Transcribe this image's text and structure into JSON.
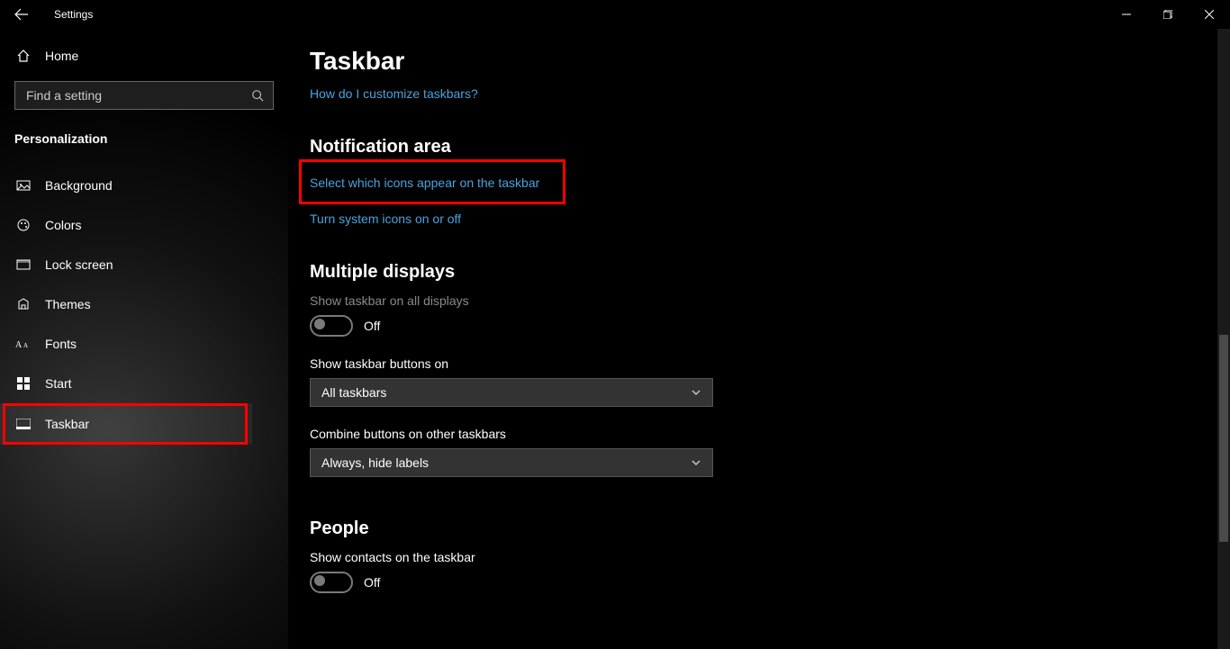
{
  "window": {
    "title": "Settings"
  },
  "sidebar": {
    "home": "Home",
    "search_placeholder": "Find a setting",
    "category": "Personalization",
    "items": [
      {
        "label": "Background"
      },
      {
        "label": "Colors"
      },
      {
        "label": "Lock screen"
      },
      {
        "label": "Themes"
      },
      {
        "label": "Fonts"
      },
      {
        "label": "Start"
      },
      {
        "label": "Taskbar"
      }
    ]
  },
  "content": {
    "title": "Taskbar",
    "help_link": "How do I customize taskbars?",
    "notification_area": {
      "heading": "Notification area",
      "link1": "Select which icons appear on the taskbar",
      "link2": "Turn system icons on or off"
    },
    "multiple_displays": {
      "heading": "Multiple displays",
      "show_all_label": "Show taskbar on all displays",
      "show_all_state": "Off",
      "buttons_on_label": "Show taskbar buttons on",
      "buttons_on_value": "All taskbars",
      "combine_label": "Combine buttons on other taskbars",
      "combine_value": "Always, hide labels"
    },
    "people": {
      "heading": "People",
      "show_contacts_label": "Show contacts on the taskbar",
      "show_contacts_state": "Off"
    }
  }
}
